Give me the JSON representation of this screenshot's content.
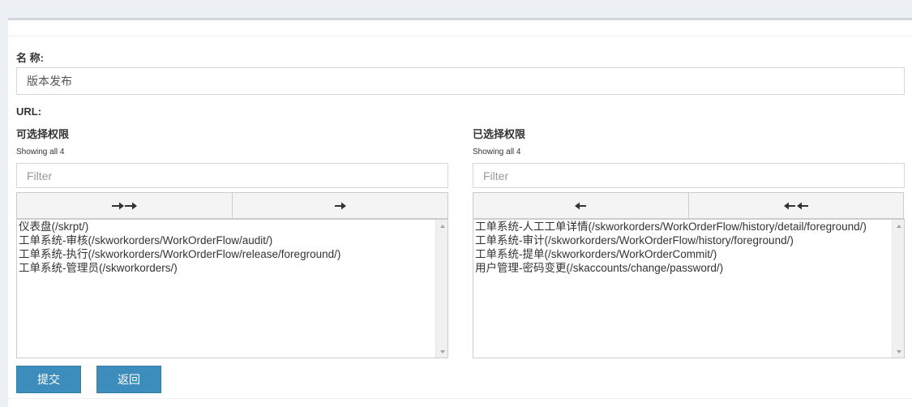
{
  "form": {
    "name_label": "名 称:",
    "name_value": "版本发布",
    "url_label": "URL:"
  },
  "available": {
    "title": "可选择权限",
    "showing": "Showing all 4",
    "filter_placeholder": "Filter",
    "move_all_icon": "double-arrow-right-icon",
    "move_selected_icon": "arrow-right-icon",
    "options": [
      "仪表盘(/skrpt/)",
      "工单系统-审核(/skworkorders/WorkOrderFlow/audit/)",
      "工单系统-执行(/skworkorders/WorkOrderFlow/release/foreground/)",
      "工单系统-管理员(/skworkorders/)"
    ]
  },
  "selected": {
    "title": "已选择权限",
    "showing": "Showing all 4",
    "filter_placeholder": "Filter",
    "remove_selected_icon": "arrow-left-icon",
    "remove_all_icon": "double-arrow-left-icon",
    "options": [
      "工单系统-人工工单详情(/skworkorders/WorkOrderFlow/history/detail/foreground/)",
      "工单系统-审计(/skworkorders/WorkOrderFlow/history/foreground/)",
      "工单系统-提单(/skworkorders/WorkOrderCommit/)",
      "用户管理-密码变更(/skaccounts/change/password/)"
    ]
  },
  "actions": {
    "submit_label": "提交",
    "back_label": "返回"
  },
  "colors": {
    "primary": "#3c8dbc",
    "background": "#ecf0f5"
  }
}
